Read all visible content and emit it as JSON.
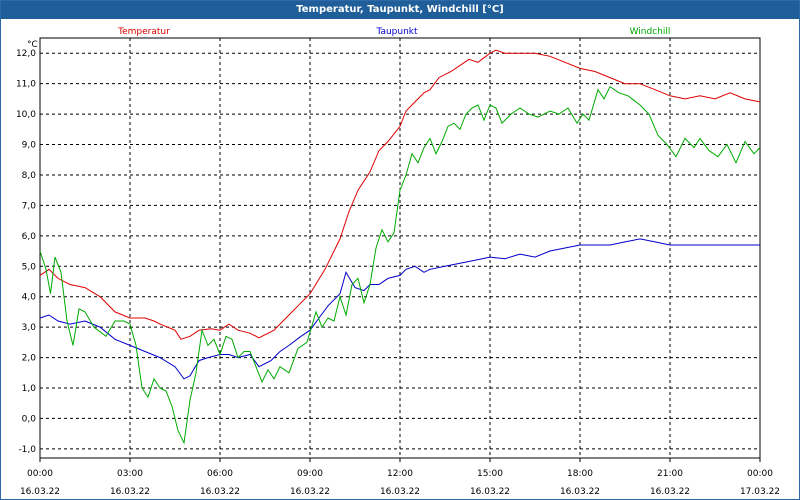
{
  "window": {
    "title": "Temperatur, Taupunkt, Windchill [°C]"
  },
  "colors": {
    "titlebar": "#1f5e99",
    "grid": "#000000"
  },
  "chart_data": {
    "type": "line",
    "title": "Temperatur, Taupunkt, Windchill [°C]",
    "ylabel": "°C",
    "xlabel": "",
    "x_range_hours": [
      0,
      24
    ],
    "ylim": [
      -1.3,
      12.5
    ],
    "grid": true,
    "legend_placement": "top",
    "y_ticks": [
      "12,0",
      "11,0",
      "10,0",
      "9,0",
      "8,0",
      "7,0",
      "6,0",
      "5,0",
      "4,0",
      "3,0",
      "2,0",
      "1,0",
      "0,0",
      "-1,0"
    ],
    "x_ticks": [
      {
        "hour": 0,
        "time": "00:00",
        "date": "16.03.22"
      },
      {
        "hour": 3,
        "time": "03:00",
        "date": "16.03.22"
      },
      {
        "hour": 6,
        "time": "06:00",
        "date": "16.03.22"
      },
      {
        "hour": 9,
        "time": "09:00",
        "date": "16.03.22"
      },
      {
        "hour": 12,
        "time": "12:00",
        "date": "16.03.22"
      },
      {
        "hour": 15,
        "time": "15:00",
        "date": "16.03.22"
      },
      {
        "hour": 18,
        "time": "18:00",
        "date": "16.03.22"
      },
      {
        "hour": 21,
        "time": "21:00",
        "date": "16.03.22"
      },
      {
        "hour": 24,
        "time": "00:00",
        "date": "17.03.22"
      }
    ],
    "series": [
      {
        "name": "Temperatur",
        "color": "#dd0000",
        "points": [
          [
            0,
            4.7
          ],
          [
            0.3,
            4.9
          ],
          [
            0.6,
            4.6
          ],
          [
            1,
            4.4
          ],
          [
            1.5,
            4.3
          ],
          [
            2,
            4.0
          ],
          [
            2.5,
            3.5
          ],
          [
            3,
            3.3
          ],
          [
            3.5,
            3.3
          ],
          [
            3.8,
            3.2
          ],
          [
            4,
            3.1
          ],
          [
            4.5,
            2.9
          ],
          [
            4.7,
            2.6
          ],
          [
            5,
            2.7
          ],
          [
            5.3,
            2.9
          ],
          [
            5.7,
            2.95
          ],
          [
            6,
            2.9
          ],
          [
            6.3,
            3.1
          ],
          [
            6.6,
            2.9
          ],
          [
            7,
            2.8
          ],
          [
            7.3,
            2.65
          ],
          [
            7.8,
            2.9
          ],
          [
            8.2,
            3.3
          ],
          [
            8.6,
            3.7
          ],
          [
            9,
            4.1
          ],
          [
            9.5,
            4.9
          ],
          [
            10,
            5.9
          ],
          [
            10.3,
            6.8
          ],
          [
            10.6,
            7.5
          ],
          [
            11,
            8.1
          ],
          [
            11.3,
            8.8
          ],
          [
            11.6,
            9.1
          ],
          [
            12,
            9.6
          ],
          [
            12.2,
            10.1
          ],
          [
            12.5,
            10.4
          ],
          [
            12.8,
            10.7
          ],
          [
            13,
            10.8
          ],
          [
            13.3,
            11.2
          ],
          [
            13.7,
            11.4
          ],
          [
            14,
            11.6
          ],
          [
            14.3,
            11.8
          ],
          [
            14.6,
            11.7
          ],
          [
            15,
            12.0
          ],
          [
            15.2,
            12.1
          ],
          [
            15.5,
            12.0
          ],
          [
            16,
            12.0
          ],
          [
            16.5,
            12.0
          ],
          [
            17,
            11.9
          ],
          [
            17.5,
            11.7
          ],
          [
            18,
            11.5
          ],
          [
            18.5,
            11.4
          ],
          [
            19,
            11.2
          ],
          [
            19.5,
            11.0
          ],
          [
            20,
            11.0
          ],
          [
            20.5,
            10.8
          ],
          [
            21,
            10.6
          ],
          [
            21.5,
            10.5
          ],
          [
            22,
            10.6
          ],
          [
            22.5,
            10.5
          ],
          [
            23,
            10.7
          ],
          [
            23.5,
            10.5
          ],
          [
            24,
            10.4
          ]
        ]
      },
      {
        "name": "Taupunkt",
        "color": "#0000cc",
        "points": [
          [
            0,
            3.3
          ],
          [
            0.3,
            3.4
          ],
          [
            0.6,
            3.2
          ],
          [
            1,
            3.1
          ],
          [
            1.5,
            3.2
          ],
          [
            2,
            3.0
          ],
          [
            2.5,
            2.6
          ],
          [
            3,
            2.4
          ],
          [
            3.5,
            2.2
          ],
          [
            4,
            2.0
          ],
          [
            4.5,
            1.7
          ],
          [
            4.8,
            1.3
          ],
          [
            5,
            1.4
          ],
          [
            5.3,
            1.9
          ],
          [
            5.6,
            2.0
          ],
          [
            6,
            2.1
          ],
          [
            6.3,
            2.1
          ],
          [
            6.6,
            2.0
          ],
          [
            7,
            2.1
          ],
          [
            7.3,
            1.7
          ],
          [
            7.7,
            1.9
          ],
          [
            8,
            2.2
          ],
          [
            8.3,
            2.4
          ],
          [
            8.7,
            2.7
          ],
          [
            9,
            2.9
          ],
          [
            9.3,
            3.3
          ],
          [
            9.6,
            3.7
          ],
          [
            10,
            4.1
          ],
          [
            10.2,
            4.8
          ],
          [
            10.5,
            4.3
          ],
          [
            10.8,
            4.2
          ],
          [
            11,
            4.4
          ],
          [
            11.3,
            4.4
          ],
          [
            11.6,
            4.6
          ],
          [
            12,
            4.7
          ],
          [
            12.2,
            4.9
          ],
          [
            12.5,
            5.0
          ],
          [
            12.8,
            4.8
          ],
          [
            13,
            4.9
          ],
          [
            13.5,
            5.0
          ],
          [
            14,
            5.1
          ],
          [
            14.5,
            5.2
          ],
          [
            15,
            5.3
          ],
          [
            15.5,
            5.25
          ],
          [
            16,
            5.4
          ],
          [
            16.5,
            5.3
          ],
          [
            17,
            5.5
          ],
          [
            17.5,
            5.6
          ],
          [
            18,
            5.7
          ],
          [
            19,
            5.7
          ],
          [
            19.5,
            5.8
          ],
          [
            20,
            5.9
          ],
          [
            20.5,
            5.8
          ],
          [
            21,
            5.7
          ],
          [
            22,
            5.7
          ],
          [
            23,
            5.7
          ],
          [
            24,
            5.7
          ]
        ]
      },
      {
        "name": "Windchill",
        "color": "#00aa00",
        "points": [
          [
            0,
            5.5
          ],
          [
            0.2,
            4.9
          ],
          [
            0.35,
            4.1
          ],
          [
            0.5,
            5.3
          ],
          [
            0.7,
            4.8
          ],
          [
            0.9,
            3.2
          ],
          [
            1.1,
            2.4
          ],
          [
            1.3,
            3.6
          ],
          [
            1.5,
            3.5
          ],
          [
            1.8,
            3.0
          ],
          [
            2.2,
            2.7
          ],
          [
            2.5,
            3.2
          ],
          [
            2.8,
            3.2
          ],
          [
            3,
            3.1
          ],
          [
            3.2,
            2.4
          ],
          [
            3.4,
            1.0
          ],
          [
            3.6,
            0.7
          ],
          [
            3.8,
            1.3
          ],
          [
            4,
            1.0
          ],
          [
            4.2,
            0.9
          ],
          [
            4.4,
            0.4
          ],
          [
            4.6,
            -0.4
          ],
          [
            4.8,
            -0.8
          ],
          [
            5,
            0.6
          ],
          [
            5.2,
            1.5
          ],
          [
            5.4,
            2.9
          ],
          [
            5.6,
            2.4
          ],
          [
            5.8,
            2.6
          ],
          [
            6,
            2.1
          ],
          [
            6.2,
            2.7
          ],
          [
            6.4,
            2.6
          ],
          [
            6.6,
            2.0
          ],
          [
            6.8,
            2.2
          ],
          [
            7,
            2.2
          ],
          [
            7.2,
            1.7
          ],
          [
            7.4,
            1.2
          ],
          [
            7.6,
            1.6
          ],
          [
            7.8,
            1.3
          ],
          [
            8,
            1.7
          ],
          [
            8.3,
            1.5
          ],
          [
            8.6,
            2.3
          ],
          [
            8.9,
            2.5
          ],
          [
            9.2,
            3.5
          ],
          [
            9.4,
            3.0
          ],
          [
            9.6,
            3.3
          ],
          [
            9.8,
            3.2
          ],
          [
            10,
            4.0
          ],
          [
            10.2,
            3.4
          ],
          [
            10.4,
            4.4
          ],
          [
            10.6,
            4.6
          ],
          [
            10.8,
            3.8
          ],
          [
            11,
            4.4
          ],
          [
            11.2,
            5.6
          ],
          [
            11.4,
            6.2
          ],
          [
            11.6,
            5.8
          ],
          [
            11.8,
            6.1
          ],
          [
            12,
            7.5
          ],
          [
            12.2,
            8.0
          ],
          [
            12.4,
            8.7
          ],
          [
            12.6,
            8.4
          ],
          [
            12.8,
            8.9
          ],
          [
            13,
            9.2
          ],
          [
            13.2,
            8.7
          ],
          [
            13.4,
            9.1
          ],
          [
            13.6,
            9.6
          ],
          [
            13.8,
            9.7
          ],
          [
            14,
            9.5
          ],
          [
            14.2,
            10.0
          ],
          [
            14.4,
            10.2
          ],
          [
            14.6,
            10.3
          ],
          [
            14.8,
            9.8
          ],
          [
            15,
            10.3
          ],
          [
            15.2,
            10.2
          ],
          [
            15.4,
            9.7
          ],
          [
            15.7,
            10.0
          ],
          [
            16,
            10.2
          ],
          [
            16.3,
            10.0
          ],
          [
            16.6,
            9.9
          ],
          [
            17,
            10.1
          ],
          [
            17.3,
            10.0
          ],
          [
            17.6,
            10.2
          ],
          [
            17.9,
            9.7
          ],
          [
            18.1,
            10.0
          ],
          [
            18.3,
            9.8
          ],
          [
            18.6,
            10.8
          ],
          [
            18.8,
            10.5
          ],
          [
            19,
            10.9
          ],
          [
            19.3,
            10.7
          ],
          [
            19.6,
            10.6
          ],
          [
            20,
            10.3
          ],
          [
            20.3,
            10.0
          ],
          [
            20.6,
            9.3
          ],
          [
            20.9,
            9.0
          ],
          [
            21.2,
            8.6
          ],
          [
            21.5,
            9.2
          ],
          [
            21.8,
            8.9
          ],
          [
            22,
            9.2
          ],
          [
            22.3,
            8.8
          ],
          [
            22.6,
            8.6
          ],
          [
            22.9,
            9.0
          ],
          [
            23.2,
            8.4
          ],
          [
            23.5,
            9.1
          ],
          [
            23.8,
            8.7
          ],
          [
            24,
            8.9
          ]
        ]
      }
    ]
  }
}
